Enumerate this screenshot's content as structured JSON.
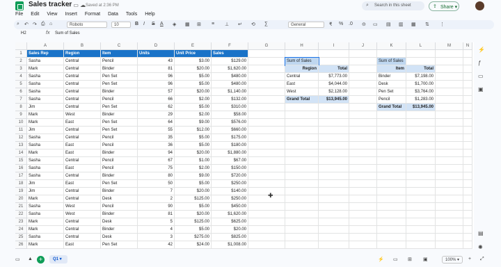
{
  "titlebar": {
    "title": "Sales tracker",
    "icons": "☆ ▭ ☁",
    "saved": "Saved at 2:36 PM",
    "search_placeholder": "Search in this sheet",
    "share_label": "Share"
  },
  "menu": [
    "File",
    "Edit",
    "View",
    "Insert",
    "Format",
    "Data",
    "Tools",
    "Help"
  ],
  "toolbar": {
    "font": "Roboto",
    "size": "10",
    "format": "General",
    "bold": "B",
    "italic": "I",
    "strike": "S",
    "textcolor": "A"
  },
  "formula": {
    "cell_ref": "H2",
    "fx": "fx",
    "value": "Sum of Sales"
  },
  "columns": [
    "A",
    "B",
    "C",
    "D",
    "E",
    "F",
    "G",
    "H",
    "I",
    "J",
    "K",
    "L",
    "M",
    "N"
  ],
  "rows": [
    "1",
    "2",
    "3",
    "4",
    "5",
    "6",
    "7",
    "8",
    "9",
    "10",
    "11",
    "12",
    "13",
    "14",
    "15",
    "16",
    "17",
    "18",
    "19",
    "20",
    "21",
    "22",
    "23",
    "24",
    "25",
    "26"
  ],
  "table": {
    "headers": [
      "Sales Rep",
      "Region",
      "Item",
      "Units",
      "Unit Price",
      "Sales"
    ],
    "rows": [
      [
        "Sasha",
        "Central",
        "Pencil",
        "43",
        "$3.00",
        "$129.00"
      ],
      [
        "Mark",
        "Central",
        "Binder",
        "81",
        "$20.00",
        "$1,620.00"
      ],
      [
        "Sasha",
        "Central",
        "Pen Set",
        "96",
        "$5.00",
        "$480.00"
      ],
      [
        "Sasha",
        "Central",
        "Pen Set",
        "96",
        "$5.00",
        "$480.00"
      ],
      [
        "Sasha",
        "Central",
        "Binder",
        "57",
        "$20.00",
        "$1,140.00"
      ],
      [
        "Sasha",
        "Central",
        "Pencil",
        "66",
        "$2.00",
        "$132.00"
      ],
      [
        "Jim",
        "Central",
        "Pen Set",
        "62",
        "$5.00",
        "$310.00"
      ],
      [
        "Mark",
        "West",
        "Binder",
        "29",
        "$2.00",
        "$58.00"
      ],
      [
        "Mark",
        "East",
        "Pen Set",
        "64",
        "$9.00",
        "$576.00"
      ],
      [
        "Jim",
        "Central",
        "Pen Set",
        "55",
        "$12.00",
        "$660.00"
      ],
      [
        "Sasha",
        "Central",
        "Pencil",
        "35",
        "$5.00",
        "$175.00"
      ],
      [
        "Sasha",
        "East",
        "Pencil",
        "36",
        "$5.00",
        "$180.00"
      ],
      [
        "Mark",
        "East",
        "Binder",
        "94",
        "$20.00",
        "$1,880.00"
      ],
      [
        "Sasha",
        "Central",
        "Pencil",
        "67",
        "$1.00",
        "$67.00"
      ],
      [
        "Sasha",
        "East",
        "Pencil",
        "75",
        "$2.00",
        "$150.00"
      ],
      [
        "Sasha",
        "Central",
        "Binder",
        "80",
        "$9.00",
        "$720.00"
      ],
      [
        "Jim",
        "East",
        "Pen Set",
        "50",
        "$5.00",
        "$250.00"
      ],
      [
        "Jim",
        "Central",
        "Binder",
        "7",
        "$20.00",
        "$140.00"
      ],
      [
        "Mark",
        "Central",
        "Desk",
        "2",
        "$125.00",
        "$250.00"
      ],
      [
        "Sasha",
        "West",
        "Pencil",
        "90",
        "$5.00",
        "$450.00"
      ],
      [
        "Sasha",
        "West",
        "Binder",
        "81",
        "$20.00",
        "$1,620.00"
      ],
      [
        "Mark",
        "Central",
        "Desk",
        "5",
        "$125.00",
        "$625.00"
      ],
      [
        "Mark",
        "Central",
        "Binder",
        "4",
        "$5.00",
        "$20.00"
      ],
      [
        "Sasha",
        "Central",
        "Desk",
        "3",
        "$275.00",
        "$825.00"
      ],
      [
        "Mark",
        "East",
        "Pen Set",
        "42",
        "$24.00",
        "$1,008.00"
      ]
    ]
  },
  "pivot_region": {
    "title": "Sum of Sales",
    "row_header": "Region",
    "value_header": "Total",
    "rows": [
      [
        "Central",
        "$7,773.00"
      ],
      [
        "East",
        "$4,044.00"
      ],
      [
        "West",
        "$2,128.00"
      ]
    ],
    "grand": [
      "Grand Total",
      "$13,945.00"
    ]
  },
  "pivot_item": {
    "title": "Sum of Sales",
    "row_header": "Item",
    "value_header": "Total",
    "rows": [
      [
        "Binder",
        "$7,198.00"
      ],
      [
        "Desk",
        "$1,700.00"
      ],
      [
        "Pen Set",
        "$3,764.00"
      ],
      [
        "Pencil",
        "$1,283.00"
      ]
    ],
    "grand": [
      "Grand Total",
      "$13,945.00"
    ]
  },
  "bottom": {
    "sheet_tab": "Q1",
    "zoom": "100%"
  }
}
